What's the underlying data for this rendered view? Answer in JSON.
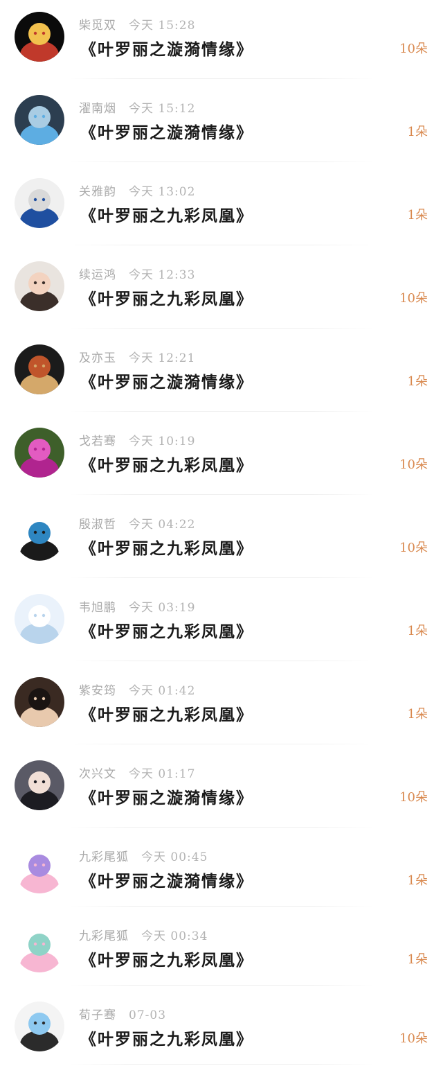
{
  "messages": [
    {
      "user": "柴觅双",
      "time": "今天 15:28",
      "title": "《叶罗丽之漩漪情缘》",
      "count": "10朵",
      "avatar_icon": "horned-hero-avatar-icon",
      "avatar_colors": [
        "#0b0b0b",
        "#c0392b",
        "#f2c14e"
      ]
    },
    {
      "user": "濯南烟",
      "time": "今天 15:12",
      "title": "《叶罗丽之漩漪情缘》",
      "count": "1朵",
      "avatar_icon": "robot-avatar-icon",
      "avatar_colors": [
        "#2c3e50",
        "#5dade2",
        "#a9cce3"
      ]
    },
    {
      "user": "关雅韵",
      "time": "今天 13:02",
      "title": "《叶罗丽之九彩凤凰》",
      "count": "1朵",
      "avatar_icon": "bus-avatar-icon",
      "avatar_colors": [
        "#f0f0f0",
        "#1f4fa0",
        "#d9d9d9"
      ]
    },
    {
      "user": "续运鸿",
      "time": "今天 12:33",
      "title": "《叶罗丽之九彩凤凰》",
      "count": "10朵",
      "avatar_icon": "girl-photo-avatar-icon",
      "avatar_colors": [
        "#e9e4df",
        "#3b2f2a",
        "#f3d3c0"
      ]
    },
    {
      "user": "及亦玉",
      "time": "今天 12:21",
      "title": "《叶罗丽之漩漪情缘》",
      "count": "1朵",
      "avatar_icon": "food-bowl-avatar-icon",
      "avatar_colors": [
        "#1b1b1b",
        "#d4a86a",
        "#c0552b"
      ]
    },
    {
      "user": "戈若骞",
      "time": "今天 10:19",
      "title": "《叶罗丽之九彩凤凰》",
      "count": "10朵",
      "avatar_icon": "orchid-flower-avatar-icon",
      "avatar_colors": [
        "#3e5f2a",
        "#b0248f",
        "#e35bc1"
      ]
    },
    {
      "user": "殷淑哲",
      "time": "今天 04:22",
      "title": "《叶罗丽之九彩凤凰》",
      "count": "10朵",
      "avatar_icon": "panda-avatar-icon",
      "avatar_colors": [
        "#ffffff",
        "#1a1a1a",
        "#2e86c1"
      ]
    },
    {
      "user": "韦旭鹏",
      "time": "今天 03:19",
      "title": "《叶罗丽之九彩凤凰》",
      "count": "1朵",
      "avatar_icon": "anime-girl-avatar-icon",
      "avatar_colors": [
        "#eaf2fb",
        "#b9d4ec",
        "#ffffff"
      ]
    },
    {
      "user": "紫安筠",
      "time": "今天 01:42",
      "title": "《叶罗丽之九彩凤凰》",
      "count": "1朵",
      "avatar_icon": "boy-photo-avatar-icon",
      "avatar_colors": [
        "#3a2a22",
        "#e8c9ad",
        "#1a1412"
      ]
    },
    {
      "user": "次兴文",
      "time": "今天 01:17",
      "title": "《叶罗丽之漩漪情缘》",
      "count": "10朵",
      "avatar_icon": "dark-hair-girl-avatar-icon",
      "avatar_colors": [
        "#5a5a66",
        "#1c1c22",
        "#f1dfd6"
      ]
    },
    {
      "user": "九彩尾狐",
      "time": "今天 00:45",
      "title": "《叶罗丽之漩漪情缘》",
      "count": "1朵",
      "avatar_icon": "rainbow-fox-avatar-icon",
      "avatar_colors": [
        "#ffffff",
        "#f7b6d2",
        "#a98be0"
      ]
    },
    {
      "user": "九彩尾狐",
      "time": "今天 00:34",
      "title": "《叶罗丽之九彩凤凰》",
      "count": "1朵",
      "avatar_icon": "rainbow-fox-avatar-icon",
      "avatar_colors": [
        "#ffffff",
        "#f7b6d2",
        "#8fd3c7"
      ]
    },
    {
      "user": "荀子骞",
      "time": "07-03",
      "title": "《叶罗丽之九彩凤凰》",
      "count": "10朵",
      "avatar_icon": "anime-boy-avatar-icon",
      "avatar_colors": [
        "#f4f4f4",
        "#2b2b2b",
        "#8ec9f0"
      ]
    }
  ],
  "accent_color": "#d9894f"
}
